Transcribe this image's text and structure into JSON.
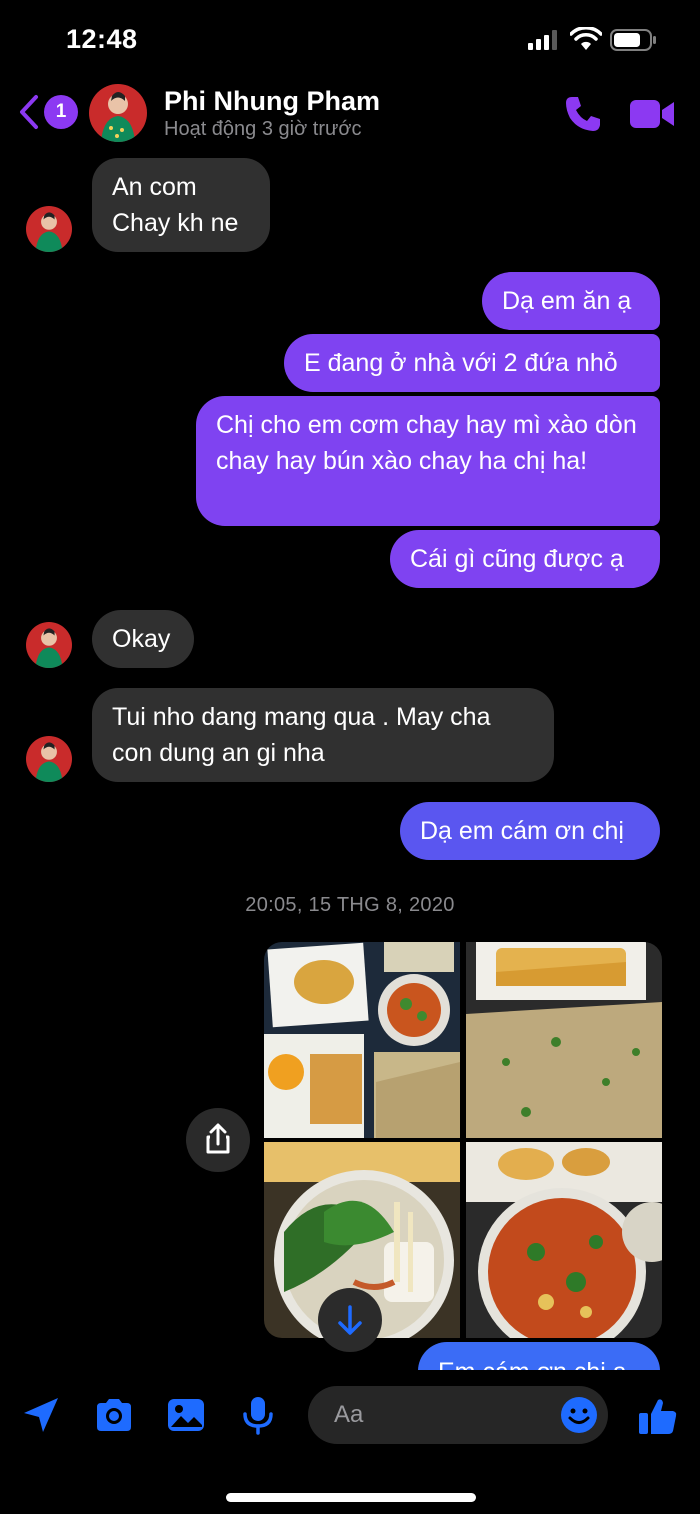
{
  "status_bar": {
    "time": "12:48"
  },
  "header": {
    "back_badge_count": "1",
    "contact_name": "Phi Nhung Pham",
    "contact_status": "Hoạt động 3 giờ trước",
    "accent_color": "#8c39f2"
  },
  "messages": [
    {
      "direction": "incoming",
      "text": "An com\nChay kh ne"
    },
    {
      "direction": "outgoing",
      "text": "Dạ em ăn ạ"
    },
    {
      "direction": "outgoing",
      "text": "E đang ở nhà với 2 đứa nhỏ"
    },
    {
      "direction": "outgoing",
      "text": "Chị cho em cơm chay hay mì xào dòn chay hay bún xào chay ha chị ha!"
    },
    {
      "direction": "outgoing",
      "text": "Cái gì cũng được ạ"
    },
    {
      "direction": "incoming",
      "text": "Okay"
    },
    {
      "direction": "incoming",
      "text": "Tui nho dang mang qua . May cha con dung an gi nha"
    },
    {
      "direction": "outgoing",
      "text": "Dạ em cám ơn chị"
    },
    {
      "direction": "outgoing",
      "text": "Em cám ơn chị ạ"
    }
  ],
  "timestamp": "20:05, 15 THG 8, 2020",
  "photos": [
    {
      "icon": "vegetarian-food-photo-1"
    },
    {
      "icon": "vegetarian-food-photo-2"
    },
    {
      "icon": "vegetarian-food-photo-3"
    },
    {
      "icon": "vegetarian-food-photo-4"
    }
  ],
  "composer": {
    "placeholder": "Aa",
    "icons": [
      "location-arrow-icon",
      "camera-icon",
      "photo-gallery-icon",
      "microphone-icon",
      "emoji-icon",
      "thumbs-up-icon"
    ]
  },
  "colors": {
    "outgoing_bubble": "#7f43f1",
    "incoming_bubble": "#303030",
    "icon_blue": "#1e6bff"
  }
}
